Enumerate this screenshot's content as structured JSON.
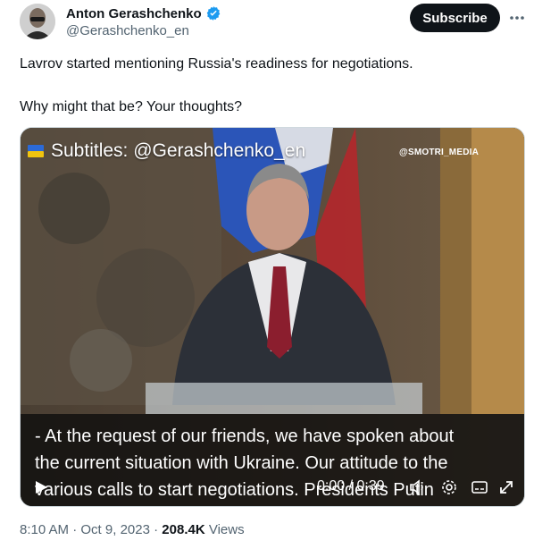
{
  "author": {
    "name": "Anton Gerashchenko",
    "handle": "@Gerashchenko_en"
  },
  "actions": {
    "subscribe_label": "Subscribe",
    "more_label": "···"
  },
  "tweet": {
    "line1": "Lavrov started mentioning Russia's readiness for negotiations.",
    "line2": "Why might that be? Your thoughts?"
  },
  "video": {
    "subtitle_overlay": "Subtitles: @Gerashchenko_en",
    "watermark": "@SMOTRI_MEDIA",
    "caption_lines": [
      "- At the request of our friends, we have spoken about",
      "the current situation with Ukraine. Our attitude to the",
      "various calls to start negotiations. Presidents Putin"
    ],
    "time": "0:00 / 0:39"
  },
  "meta": {
    "time": "8:10 AM",
    "date": "Oct 9, 2023",
    "views_count": "208.4K",
    "views_label": "Views"
  },
  "colors": {
    "accent": "#1d9bf0",
    "text": "#0f1419",
    "muted": "#536471",
    "button": "#0f1419"
  }
}
